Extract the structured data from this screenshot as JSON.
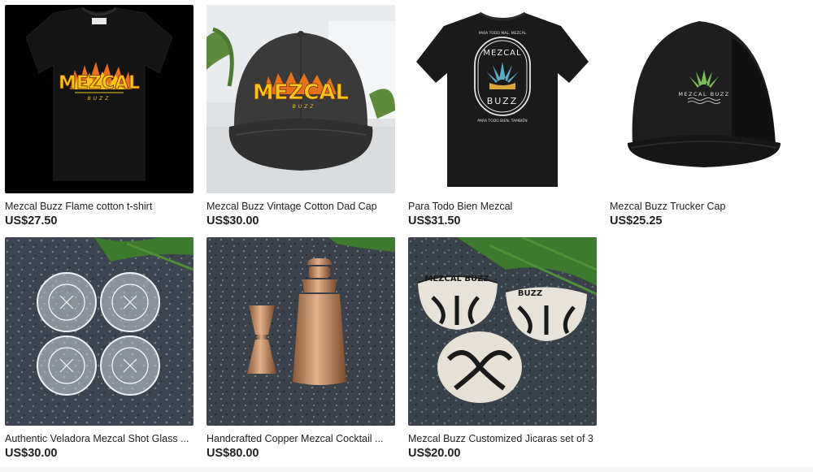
{
  "listings": [
    {
      "title": "Mezcal Buzz Flame cotton t-shirt",
      "price": "US$27.50",
      "icon": "black-flame-tshirt-image"
    },
    {
      "title": "Mezcal Buzz Vintage Cotton Dad Cap",
      "price": "US$30.00",
      "icon": "washed-black-dad-cap-image"
    },
    {
      "title": "Para Todo Bien Mezcal",
      "price": "US$31.50",
      "icon": "agave-badge-tshirt-image"
    },
    {
      "title": "Mezcal Buzz Trucker Cap",
      "price": "US$25.25",
      "icon": "black-trucker-cap-image"
    },
    {
      "title": "Authentic Veladora Mezcal Shot Glass ...",
      "price": "US$30.00",
      "icon": "veladora-shot-glasses-image"
    },
    {
      "title": "Handcrafted Copper Mezcal Cocktail ...",
      "price": "US$80.00",
      "icon": "copper-cocktail-shaker-image"
    },
    {
      "title": "Mezcal Buzz Customized Jicaras set of 3",
      "price": "US$20.00",
      "icon": "painted-jicaras-image"
    }
  ],
  "product_art": {
    "flame_logo_text": "MEZCAL",
    "flame_logo_sub": "BUZZ",
    "badge_top_text": "PARA TODO MAL, MEZCAL",
    "badge_word_1": "MEZCAL",
    "badge_word_2": "BUZZ",
    "badge_bottom_text": "PARA TODO BIEN, TAMBIÉN",
    "trucker_logo_text": "MEZCAL BUZZ",
    "jicara_text_1": "MEZCAL BUZZ",
    "jicara_text_2": "BUZZ"
  },
  "colors": {
    "flame_yellow": "#f5c518",
    "flame_orange": "#e8711a",
    "agave_green": "#7cbd5a",
    "agave_blue": "#5fa8c7",
    "copper": "#c98a5a"
  }
}
